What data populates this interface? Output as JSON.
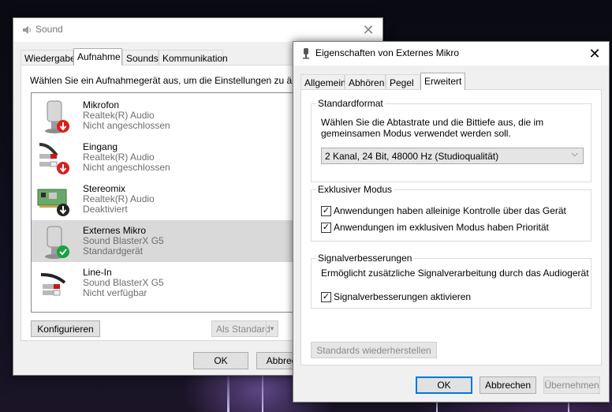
{
  "sound_window": {
    "title": "Sound",
    "tabs": [
      "Wiedergabe",
      "Aufnahme",
      "Sounds",
      "Kommunikation"
    ],
    "active_tab": "Aufnahme",
    "instruction": "Wählen Sie ein Aufnahmegerät aus, um die Einstellungen zu änd",
    "devices": [
      {
        "name": "Mikrofon",
        "driver": "Realtek(R) Audio",
        "status": "Nicht angeschlossen",
        "badge": "red-down-arrow"
      },
      {
        "name": "Eingang",
        "driver": "Realtek(R) Audio",
        "status": "Nicht angeschlossen",
        "badge": "red-down-arrow"
      },
      {
        "name": "Stereomix",
        "driver": "Realtek(R) Audio",
        "status": "Deaktiviert",
        "badge": "black-down-arrow"
      },
      {
        "name": "Externes Mikro",
        "driver": "Sound BlasterX G5",
        "status": "Standardgerät",
        "badge": "green-check"
      },
      {
        "name": "Line-In",
        "driver": "Sound BlasterX G5",
        "status": "Nicht verfügbar",
        "badge": "none"
      }
    ],
    "configure_button": "Konfigurieren",
    "set_default_button": "Als Standard",
    "ok_button": "OK",
    "cancel_button": "Abbrech"
  },
  "props_window": {
    "title": "Eigenschaften von Externes Mikro",
    "tabs": [
      "Allgemein",
      "Abhören",
      "Pegel",
      "Erweitert"
    ],
    "active_tab": "Erweitert",
    "default_format": {
      "label": "Standardformat",
      "description_line1": "Wählen Sie die Abtastrate und die Bittiefe aus, die im",
      "description_line2": "gemeinsamen Modus verwendet werden soll.",
      "selected": "2 Kanal, 24 Bit, 48000 Hz (Studioqualität)"
    },
    "exclusive_mode": {
      "label": "Exklusiver Modus",
      "options": [
        {
          "label": "Anwendungen haben alleinige Kontrolle über das Gerät",
          "checked": true
        },
        {
          "label": "Anwendungen im exklusiven Modus haben Priorität",
          "checked": true
        }
      ]
    },
    "enhancements": {
      "label": "Signalverbesserungen",
      "description": "Ermöglicht zusätzliche Signalverarbeitung durch das Audiogerät",
      "option": {
        "label": "Signalverbesserungen aktivieren",
        "checked": true
      }
    },
    "restore_button": "Standards wiederherstellen",
    "ok_button": "OK",
    "cancel_button": "Abbrechen",
    "apply_button": "Übernehmen"
  },
  "colors": {
    "accent": "#0078d7",
    "selection": "#d9d9d9",
    "status_green": "#16a33a",
    "status_red": "#d9201c"
  }
}
